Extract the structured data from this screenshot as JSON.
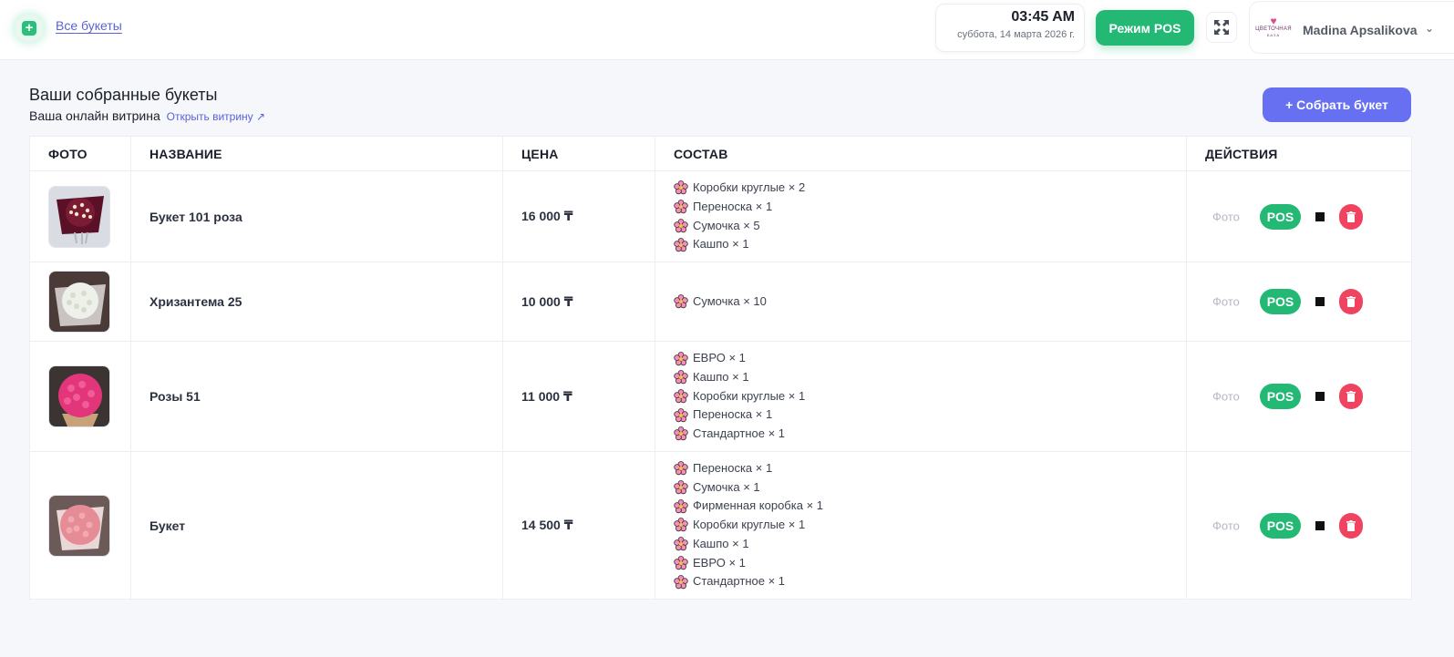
{
  "topbar": {
    "all_bouquets_link": "Все букеты",
    "time": "03:45 AM",
    "date": "суббота, 14 марта 2026 г.",
    "pos_mode_label": "Режим POS",
    "logo_line1": "ЦВЕТОЧНАЯ",
    "logo_line2": "БАЗА",
    "user_name": "Madina Apsalikova"
  },
  "header": {
    "title": "Ваши собранные букеты",
    "subtitle": "Ваша онлайн витрина",
    "open_link": "Открыть витрину ↗",
    "build_button": "+ Собрать букет"
  },
  "table": {
    "columns": {
      "photo": "ФОТО",
      "name": "НАЗВАНИЕ",
      "price": "ЦЕНА",
      "composition": "СОСТАВ",
      "actions": "ДЕЙСТВИЯ"
    },
    "action_labels": {
      "photo": "Фото",
      "pos": "POS"
    },
    "rows": [
      {
        "name": "Букет 101 роза",
        "price": "16 000 ₸",
        "composition": [
          "Коробки круглые × 2",
          "Переноска × 1",
          "Сумочка × 5",
          "Кашпо × 1"
        ]
      },
      {
        "name": "Хризантема 25",
        "price": "10 000 ₸",
        "composition": [
          "Сумочка × 10"
        ]
      },
      {
        "name": "Розы 51",
        "price": "11 000 ₸",
        "composition": [
          "ЕВРО × 1",
          "Кашпо × 1",
          "Коробки круглые × 1",
          "Переноска × 1",
          "Стандартное × 1"
        ]
      },
      {
        "name": "Букет",
        "price": "14 500 ₸",
        "composition": [
          "Переноска × 1",
          "Сумочка × 1",
          "Фирменная коробка × 1",
          "Коробки круглые × 1",
          "Кашпо × 1",
          "ЕВРО × 1",
          "Стандартное × 1"
        ]
      }
    ]
  },
  "colors": {
    "accent": "#6670f0",
    "success": "#23b874",
    "danger": "#ef4360",
    "link": "#5a63d6"
  }
}
